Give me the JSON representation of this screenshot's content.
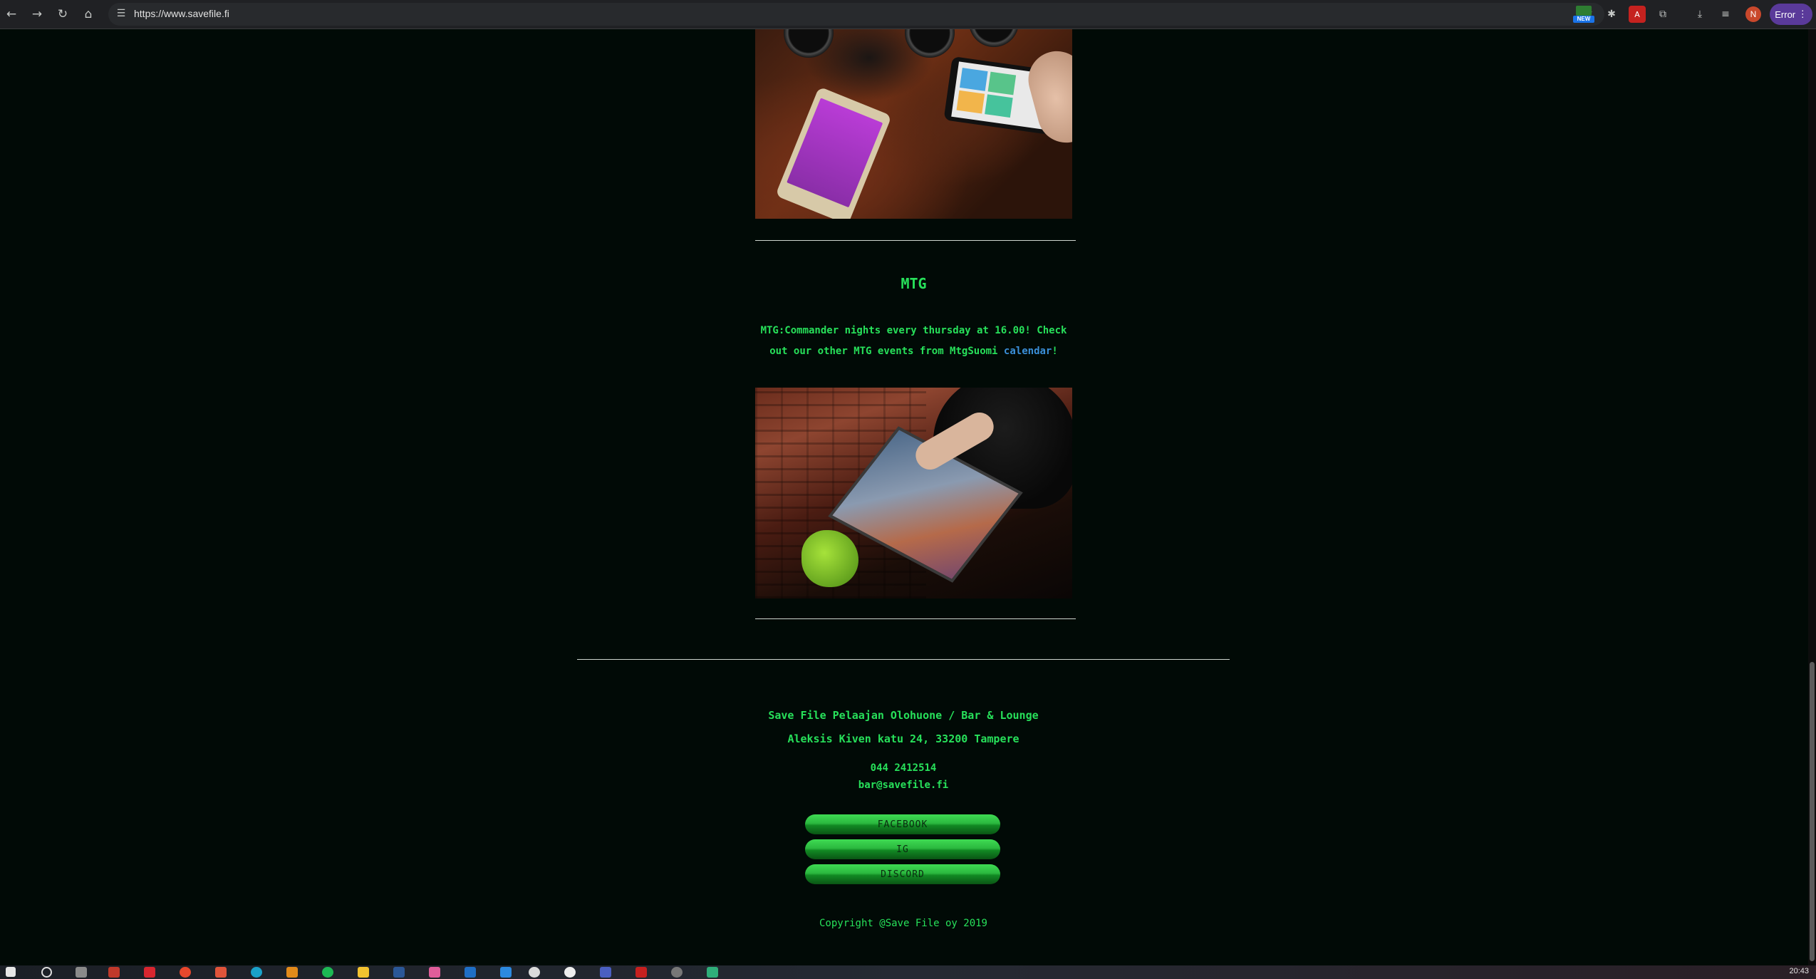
{
  "browser": {
    "url": "https://www.savefile.fi",
    "new_badge": "NEW",
    "profile_initial": "N",
    "error_label": "Error"
  },
  "mtg": {
    "title": "MTG",
    "text_before_link": "MTG:Commander nights every thursday at 16.00! Check out our other MTG events from MtgSuomi ",
    "link_text": "calendar",
    "text_after_link": "!"
  },
  "footer": {
    "name": "Save File Pelaajan Olohuone / Bar & Lounge",
    "address": "Aleksis Kiven katu 24, 33200 Tampere",
    "phone": "044 2412514",
    "email": "bar@savefile.fi",
    "buttons": [
      "FACEBOOK",
      "IG",
      "DISCORD"
    ],
    "copyright": "Copyright @Save File oy 2019"
  },
  "taskbar": {
    "clock": "20:43"
  },
  "colors": {
    "accent_green": "#27e05a",
    "link_blue": "#3a8fd8",
    "background": "#010a06"
  }
}
